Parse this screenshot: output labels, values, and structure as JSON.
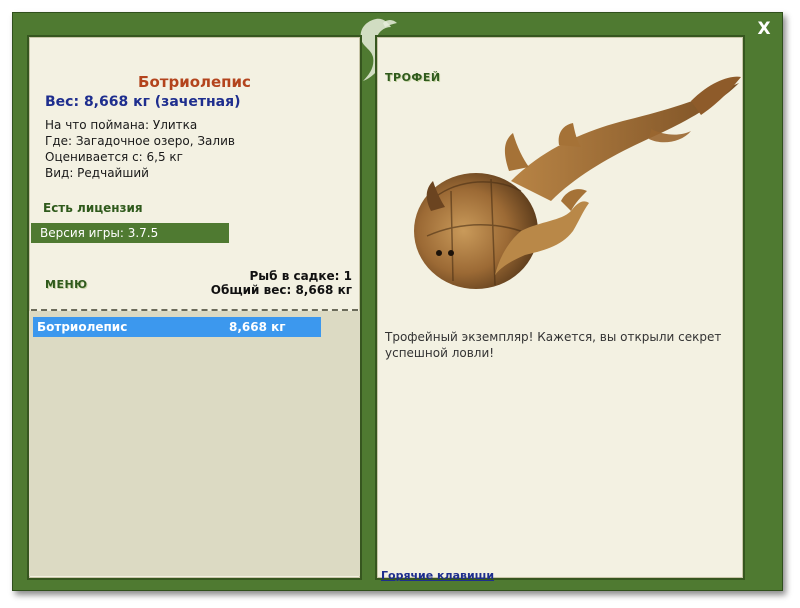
{
  "window": {
    "close_label": "X"
  },
  "fish": {
    "name": "Ботриолепис",
    "weight_line": "Вес: 8,668 кг (зачетная)",
    "info": [
      "На что поймана: Улитка",
      "Где: Загадочное озеро, Залив",
      "Оценивается с: 6,5 кг",
      "Вид: Редчайший"
    ]
  },
  "license": "Есть лицензия",
  "version": "Версия игры: 3.7.5",
  "menu_label": "МЕНЮ",
  "net": {
    "count_line": "Рыб в садке: 1",
    "total_line": "Общий вес: 8,668 кг",
    "items": [
      {
        "name": "Ботриолепис",
        "weight": "8,668 кг"
      }
    ]
  },
  "trophy": {
    "title": "ТРОФЕЙ",
    "text": "Трофейный экземпляр! Кажется, вы открыли секрет успешной ловли!"
  },
  "hotkeys": "Горячие клавиши",
  "colors": {
    "frame": "#4f7a31",
    "panel": "#f3f1e2",
    "selection": "#3c98ee",
    "fish_name": "#b3441d",
    "weight": "#1e2e8e"
  }
}
